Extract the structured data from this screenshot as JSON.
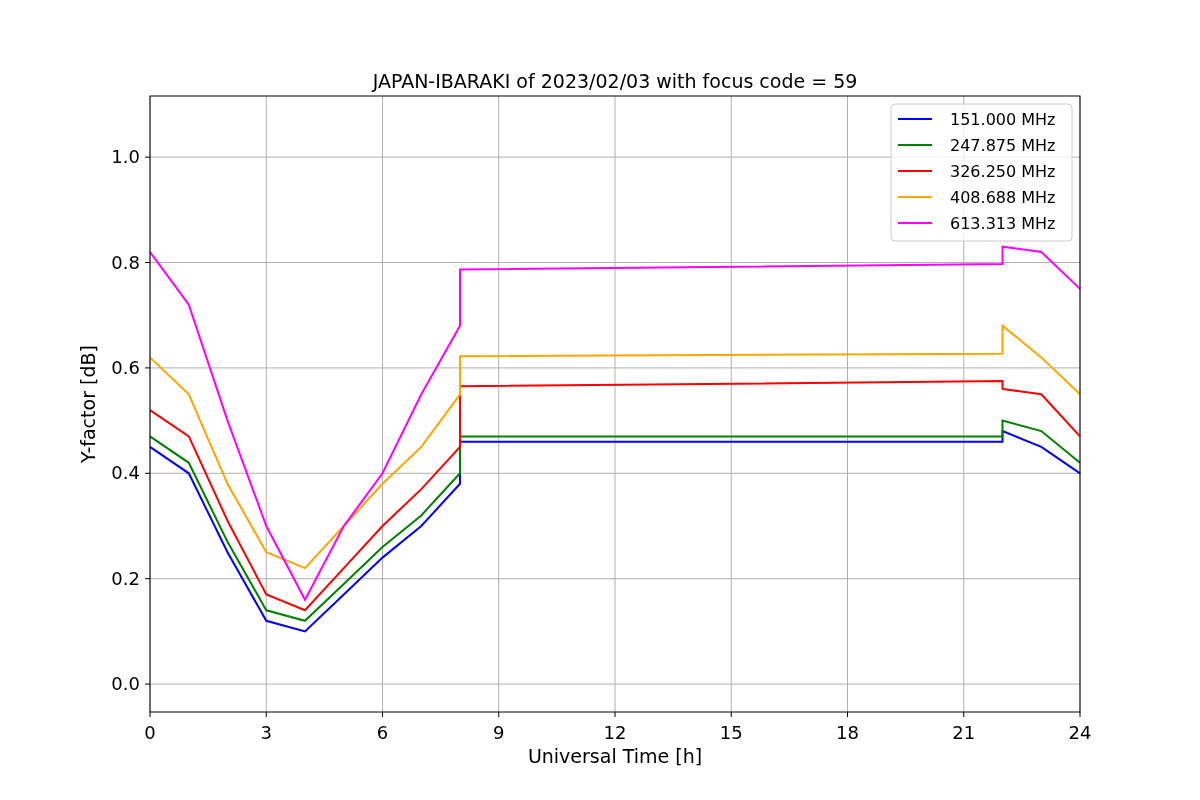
{
  "chart_data": {
    "type": "line",
    "title": "JAPAN-IBARAKI of 2023/02/03 with focus code = 59",
    "xlabel": "Universal Time [h]",
    "ylabel": "Y-factor [dB]",
    "x": [
      0,
      1,
      2,
      3,
      4,
      5,
      6,
      7,
      8,
      8,
      22,
      22,
      23,
      24
    ],
    "series": [
      {
        "name": "151.000 MHz",
        "color": "#0000ff",
        "values": [
          0.45,
          0.4,
          0.25,
          0.12,
          0.1,
          0.17,
          0.24,
          0.3,
          0.38,
          0.46,
          0.46,
          0.48,
          0.45,
          0.4
        ]
      },
      {
        "name": "247.875 MHz",
        "color": "#008000",
        "values": [
          0.47,
          0.42,
          0.27,
          0.14,
          0.12,
          0.19,
          0.26,
          0.32,
          0.4,
          0.47,
          0.47,
          0.5,
          0.48,
          0.42
        ]
      },
      {
        "name": "326.250 MHz",
        "color": "#ff0000",
        "values": [
          0.52,
          0.47,
          0.31,
          0.17,
          0.14,
          0.22,
          0.3,
          0.37,
          0.45,
          0.565,
          0.575,
          0.56,
          0.55,
          0.47
        ]
      },
      {
        "name": "408.688 MHz",
        "color": "#ffa500",
        "values": [
          0.62,
          0.55,
          0.38,
          0.25,
          0.22,
          0.3,
          0.38,
          0.45,
          0.55,
          0.622,
          0.627,
          0.68,
          0.62,
          0.55
        ]
      },
      {
        "name": "613.313 MHz",
        "color": "#ff00ff",
        "values": [
          0.82,
          0.72,
          0.5,
          0.3,
          0.16,
          0.3,
          0.4,
          0.55,
          0.68,
          0.787,
          0.797,
          0.83,
          0.82,
          0.75
        ]
      }
    ],
    "grid": true,
    "legend": true,
    "xlim": [
      0,
      24
    ],
    "ylim": [
      -0.053,
      1.116
    ],
    "xticks": [
      0,
      3,
      6,
      9,
      12,
      15,
      18,
      21,
      24
    ],
    "yticks": [
      {
        "value": 0,
        "label": "0.0"
      },
      {
        "value": 0.2,
        "label": "0.2"
      },
      {
        "value": 0.4,
        "label": "0.4"
      },
      {
        "value": 0.6,
        "label": "0.6"
      },
      {
        "value": 0.8,
        "label": "0.8"
      },
      {
        "value": 1,
        "label": "1.0"
      }
    ]
  }
}
